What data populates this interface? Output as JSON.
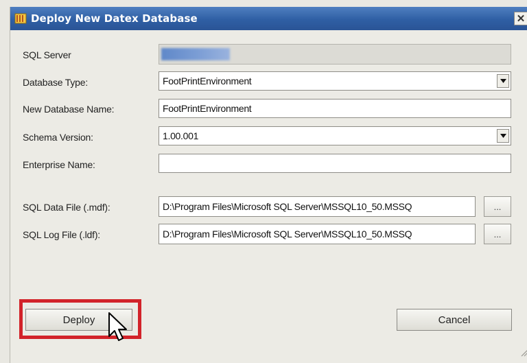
{
  "window": {
    "title": "Deploy New Datex Database",
    "close_glyph": "✕"
  },
  "form": {
    "sql_server": {
      "label": "SQL Server",
      "value_icon": "blurred-server-name"
    },
    "database_type": {
      "label": "Database Type:",
      "value": "FootPrintEnvironment"
    },
    "new_database_name": {
      "label": "New Database Name:",
      "value": "FootPrintEnvironment"
    },
    "schema_version": {
      "label": "Schema Version:",
      "value": "1.00.001"
    },
    "enterprise_name": {
      "label": "Enterprise Name:",
      "value": ""
    },
    "sql_data_file": {
      "label": "SQL Data File (.mdf):",
      "value": "D:\\Program Files\\Microsoft SQL Server\\MSSQL10_50.MSSQ",
      "browse_label": "..."
    },
    "sql_log_file": {
      "label": "SQL Log File (.ldf):",
      "value": "D:\\Program Files\\Microsoft SQL Server\\MSSQL10_50.MSSQ",
      "browse_label": "..."
    }
  },
  "buttons": {
    "deploy": "Deploy",
    "cancel": "Cancel"
  },
  "colors": {
    "titlebar": "#2f5fa4",
    "highlight": "#d2232a"
  },
  "icons": [
    "app-icon",
    "close-icon",
    "dropdown-arrow-icon",
    "mouse-cursor-icon",
    "resize-grip-icon"
  ]
}
